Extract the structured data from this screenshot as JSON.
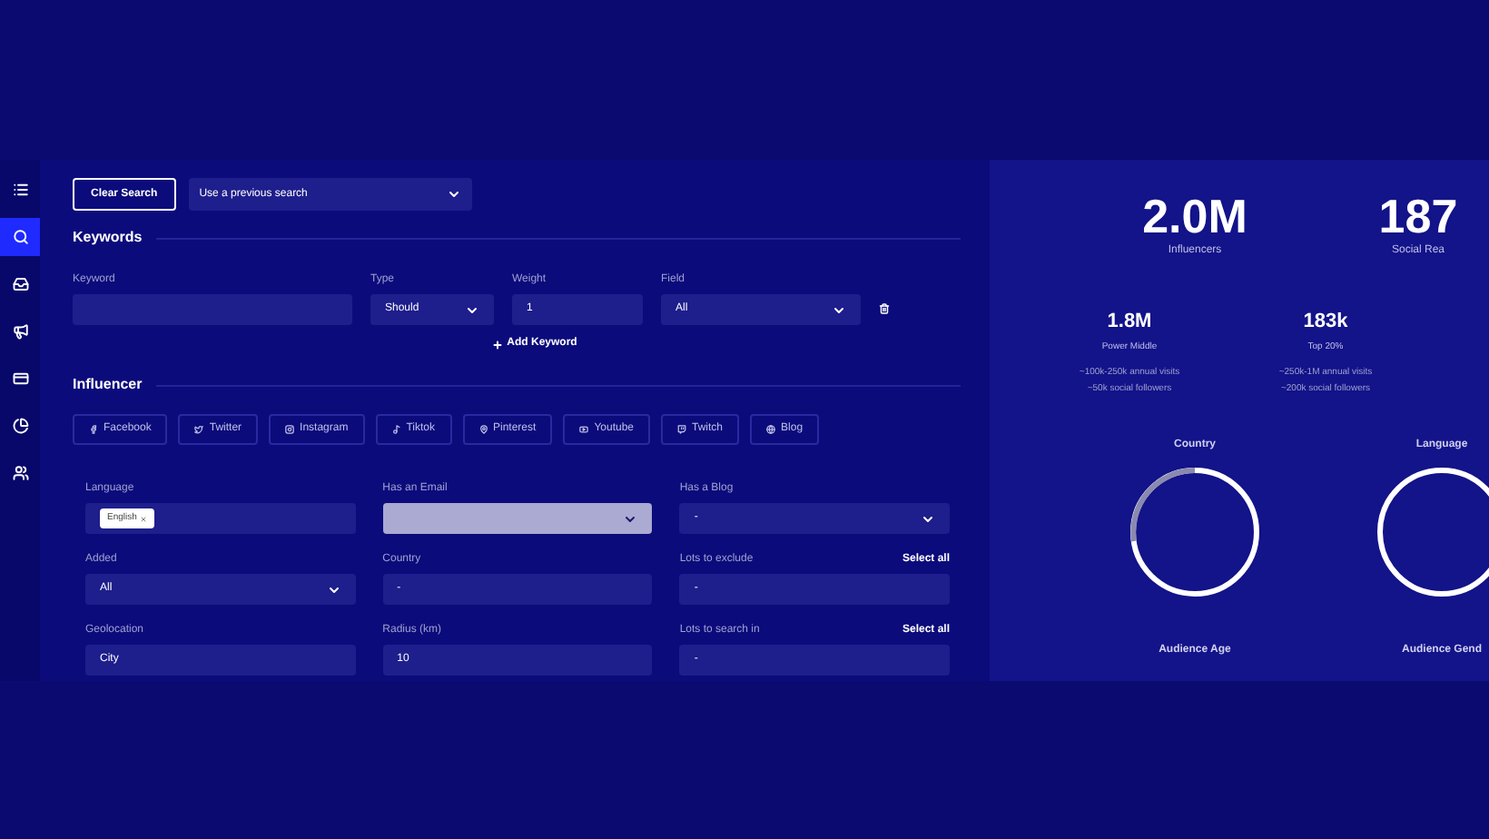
{
  "sidebar": {
    "items": [
      {
        "selected": false
      },
      {
        "selected": true
      },
      {
        "selected": false
      },
      {
        "selected": false
      },
      {
        "selected": false
      },
      {
        "selected": false
      },
      {
        "selected": false
      }
    ]
  },
  "toolbar": {
    "clear_button": "Clear Search",
    "previous_search": {
      "value": "Use a previous search"
    }
  },
  "keywords": {
    "heading": "Keywords",
    "fields": [
      {
        "label": "Keyword",
        "kind": "input"
      },
      {
        "label": "Type",
        "kind": "select",
        "value": "Should"
      },
      {
        "label": "Weight",
        "kind": "input",
        "value": "1"
      },
      {
        "label": "Field",
        "kind": "select",
        "value": "All"
      }
    ],
    "add_button": "Add Keyword"
  },
  "influencer": {
    "heading": "Influencer",
    "platforms": [
      {
        "label": "Facebook"
      },
      {
        "label": "Twitter"
      },
      {
        "label": "Instagram"
      },
      {
        "label": "Tiktok"
      },
      {
        "label": "Pinterest"
      },
      {
        "label": "Youtube"
      },
      {
        "label": "Twitch"
      },
      {
        "label": "Blog"
      }
    ],
    "filters": [
      {
        "label": "Language",
        "kind": "tags",
        "tags": [
          "English"
        ]
      },
      {
        "label": "Has an Email",
        "kind": "select",
        "highlighted": true
      },
      {
        "label": "Has a Blog",
        "kind": "select",
        "value": "-"
      },
      {
        "label": "Added",
        "kind": "select",
        "value": "All"
      },
      {
        "label": "Country",
        "kind": "input",
        "placeholder": "-"
      },
      {
        "label": "Lots to exclude",
        "kind": "input",
        "placeholder": "-",
        "action": "Select all"
      },
      {
        "label": "Geolocation",
        "kind": "input",
        "placeholder": "City"
      },
      {
        "label": "Radius (km)",
        "kind": "input",
        "value": "10"
      },
      {
        "label": "Lots to search in",
        "kind": "input",
        "placeholder": "-",
        "action": "Select all"
      }
    ]
  },
  "stats": {
    "main": [
      {
        "value": "2.0M",
        "label": "Influencers"
      },
      {
        "value": "187",
        "label": "Social Rea"
      }
    ],
    "tiers": [
      {
        "value": "1.8M",
        "label": "Power Middle",
        "notes": [
          "~100k-250k annual visits",
          "~50k social followers"
        ]
      },
      {
        "value": "183k",
        "label": "Top 20%",
        "notes": [
          "~250k-1M annual visits",
          "~200k social followers"
        ]
      }
    ],
    "charts": [
      {
        "title": "Country",
        "footer": "Audience Age"
      },
      {
        "title": "Language",
        "footer": "Audience Gend"
      }
    ]
  }
}
